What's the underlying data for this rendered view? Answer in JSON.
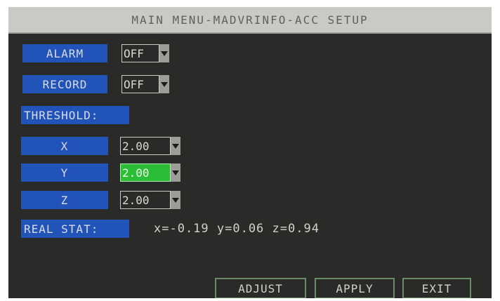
{
  "window": {
    "title": "MAIN MENU-MADVRINFO-ACC SETUP"
  },
  "alarm": {
    "label": "ALARM",
    "value": "OFF"
  },
  "record": {
    "label": "RECORD",
    "value": "OFF"
  },
  "threshold": {
    "heading": "THRESHOLD:",
    "x": {
      "label": "X",
      "value": "2.00"
    },
    "y": {
      "label": "Y",
      "value": "2.00"
    },
    "z": {
      "label": "Z",
      "value": "2.00"
    }
  },
  "real_stat": {
    "label": "REAL STAT:",
    "readout": "x=-0.19 y=0.06 z=0.94"
  },
  "buttons": {
    "adjust": "ADJUST",
    "apply": "APPLY",
    "exit": "EXIT"
  },
  "colors": {
    "label_bg": "#2153b8",
    "selected_bg": "#2bbd35",
    "panel_bg": "#2a2a28",
    "title_bg": "#c9c9c6"
  },
  "icons": {
    "dropdown": "triangle-down-icon"
  }
}
